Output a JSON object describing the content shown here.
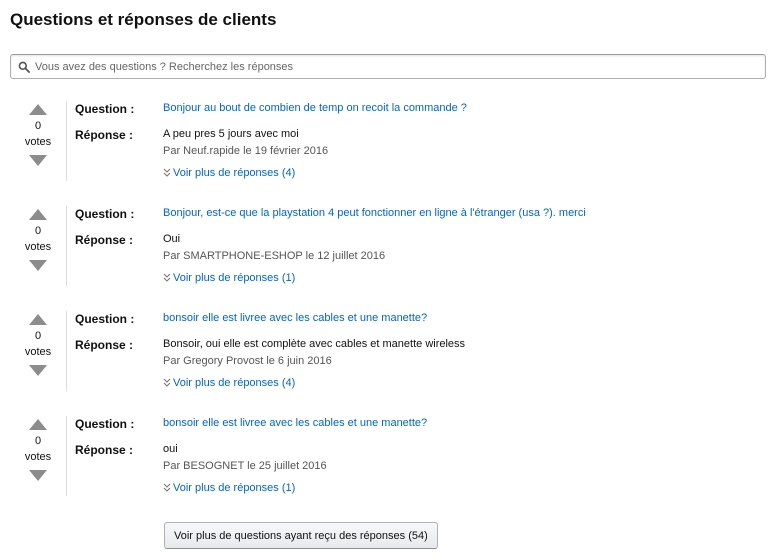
{
  "header": {
    "title": "Questions et réponses de clients"
  },
  "search": {
    "placeholder": "Vous avez des questions ? Recherchez les réponses",
    "icon": "search-icon"
  },
  "labels": {
    "question": "Question :",
    "answer": "Réponse :",
    "votes": "votes"
  },
  "questions": [
    {
      "votes": "0",
      "question": "Bonjour au bout de combien de temp on recoit la commande ?",
      "answer": "A peu pres 5 jours avec moi",
      "meta": "Par Neuf.rapide le 19 février 2016",
      "more": "Voir plus de réponses (4)"
    },
    {
      "votes": "0",
      "question": "Bonjour, est-ce que la playstation 4 peut fonctionner en ligne à l'étranger (usa ?). merci",
      "answer": "Oui",
      "meta": "Par SMARTPHONE-ESHOP le 12 juillet 2016",
      "more": "Voir plus de réponses (1)"
    },
    {
      "votes": "0",
      "question": "bonsoir elle est livree avec les cables et une manette?",
      "answer": "Bonsoir, oui elle est complète avec cables et manette wireless",
      "meta": "Par Gregory Provost le 6 juin 2016",
      "more": "Voir plus de réponses (4)"
    },
    {
      "votes": "0",
      "question": "bonsoir elle est livree avec les cables et une manette?",
      "answer": "oui",
      "meta": "Par BESOGNET le 25 juillet 2016",
      "more": "Voir plus de réponses (1)"
    }
  ],
  "footer": {
    "more_questions_label": "Voir plus de questions ayant reçu des réponses (54)"
  },
  "colors": {
    "link": "#0066c0",
    "vote_arrow": "#8c8c8c",
    "text": "#111111",
    "meta": "#555555"
  }
}
